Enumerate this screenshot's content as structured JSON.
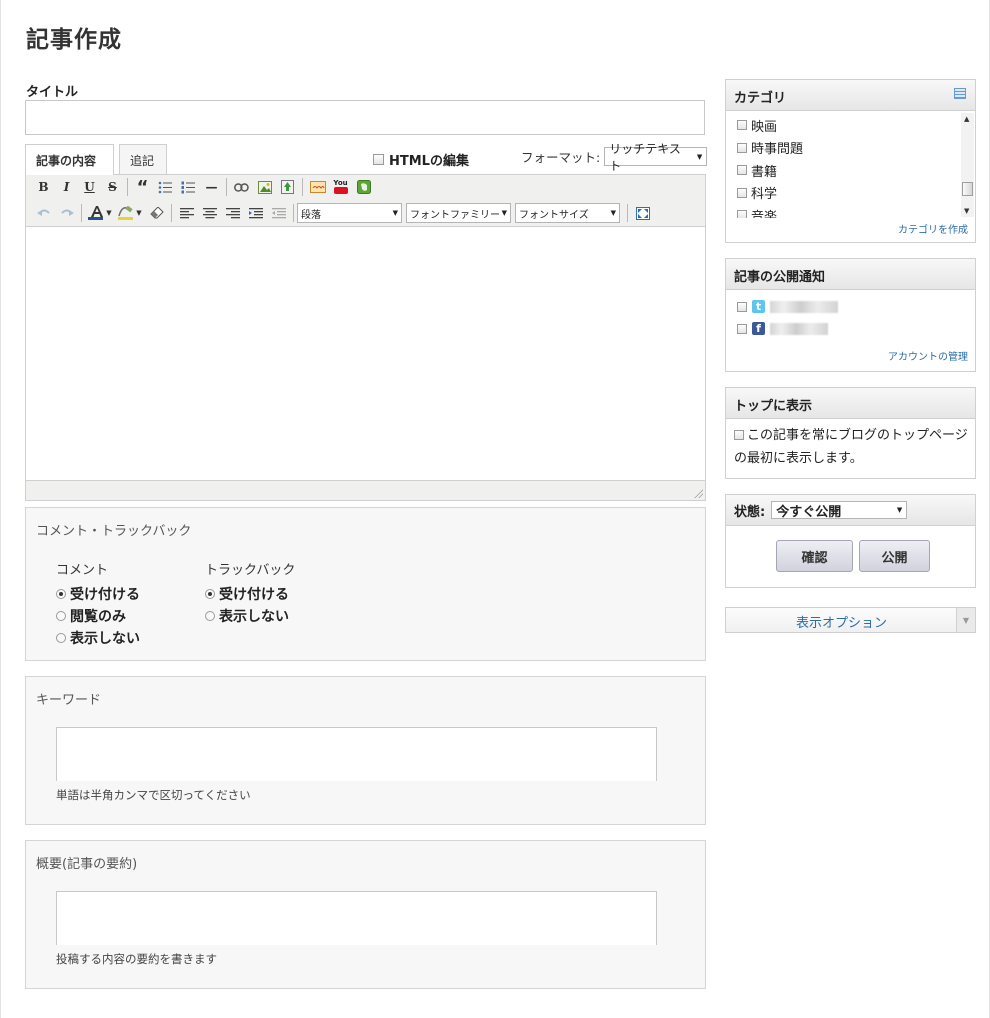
{
  "page": {
    "title": "記事作成"
  },
  "title_field": {
    "label": "タイトル",
    "value": ""
  },
  "editor": {
    "tabs": [
      {
        "label": "記事の内容"
      },
      {
        "label": "追記"
      }
    ],
    "html_edit_label": "HTMLの編集",
    "format": {
      "label": "フォーマット:",
      "selected": "リッチテキスト"
    },
    "toolbar": {
      "bold": "B",
      "italic": "I",
      "underline": "U",
      "strike": "S",
      "quote": "“",
      "hr": "—",
      "paragraph_select": "段落",
      "font_family_select": "フォントファミリー",
      "font_size_select": "フォントサイズ",
      "youtube": "You"
    }
  },
  "comments_panel": {
    "title": "コメント・トラックバック",
    "comment": {
      "label": "コメント",
      "options": [
        "受け付ける",
        "閲覧のみ",
        "表示しない"
      ],
      "selected": "受け付ける"
    },
    "trackback": {
      "label": "トラックバック",
      "options": [
        "受け付ける",
        "表示しない"
      ],
      "selected": "受け付ける"
    }
  },
  "keyword_panel": {
    "title": "キーワード",
    "hint": "単語は半角カンマで区切ってください",
    "value": ""
  },
  "summary_panel": {
    "title": "概要(記事の要約)",
    "hint": "投稿する内容の要約を書きます",
    "value": ""
  },
  "category_panel": {
    "title": "カテゴリ",
    "items": [
      "映画",
      "時事問題",
      "書籍",
      "科学",
      "音楽"
    ],
    "create_link": "カテゴリを作成"
  },
  "notify_panel": {
    "title": "記事の公開通知",
    "manage_link": "アカウントの管理",
    "twitter_glyph": "t",
    "facebook_glyph": "f"
  },
  "top_panel": {
    "title": "トップに表示",
    "text": "この記事を常にブログのトップページの最初に表示します。"
  },
  "status_panel": {
    "label": "状態:",
    "selected": "今すぐ公開",
    "confirm_button": "確認",
    "publish_button": "公開"
  },
  "display_options": {
    "label": "表示オプション"
  },
  "colors": {
    "link": "#2b6da8",
    "panel_bg": "#f7f7f7",
    "border": "#d0d0d0"
  }
}
